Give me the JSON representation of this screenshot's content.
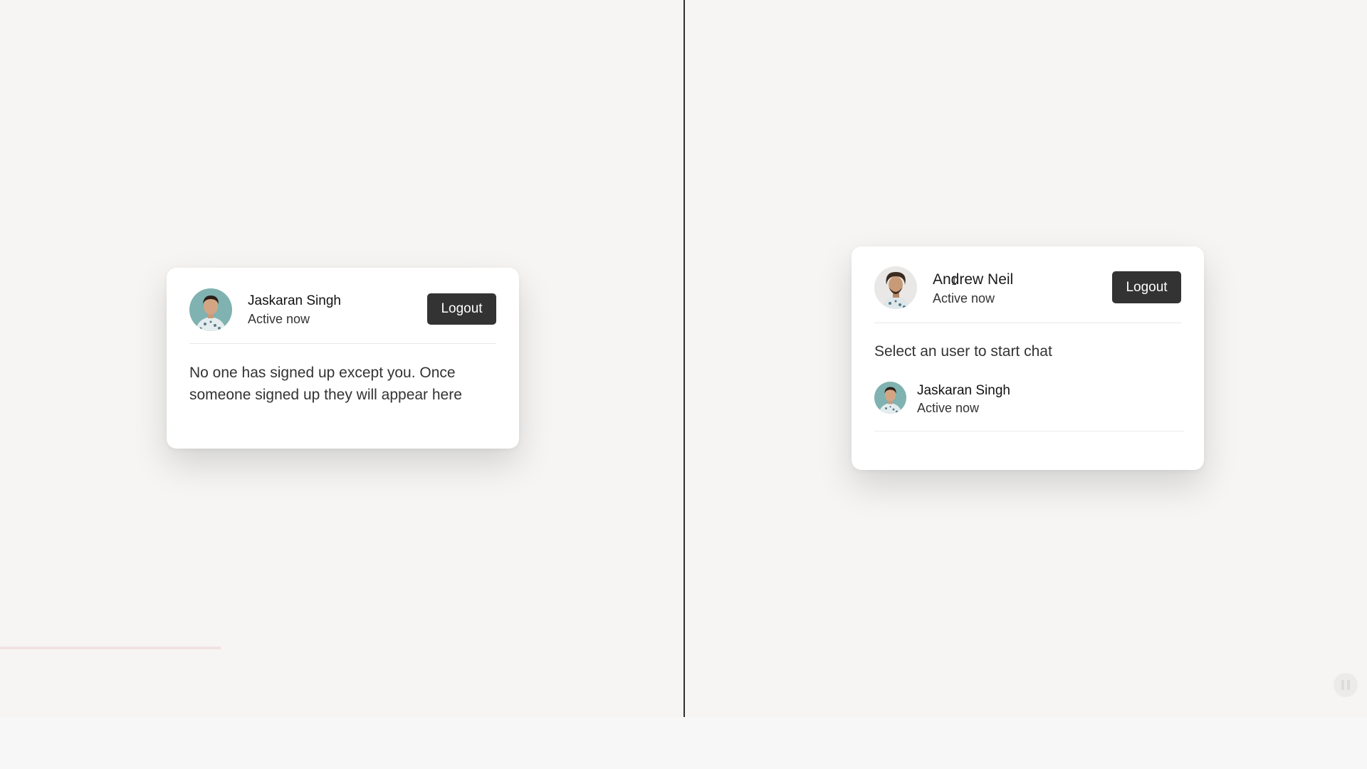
{
  "left_card": {
    "user": {
      "name": "Jaskaran Singh",
      "status": "Active now"
    },
    "logout_label": "Logout",
    "empty_message": "No one has signed up except you. Once someone signed up they will appear here"
  },
  "right_card": {
    "user": {
      "name": "Andrew Neil",
      "status": "Active now"
    },
    "logout_label": "Logout",
    "section_title": "Select an user to start chat",
    "users": [
      {
        "name": "Jaskaran Singh",
        "status": "Active now"
      }
    ]
  },
  "icons": {
    "player_control": "pause-icon"
  },
  "colors": {
    "button_bg": "#333333",
    "divider": "#2e2e2e",
    "avatar_bg": "#7fb2b0"
  }
}
